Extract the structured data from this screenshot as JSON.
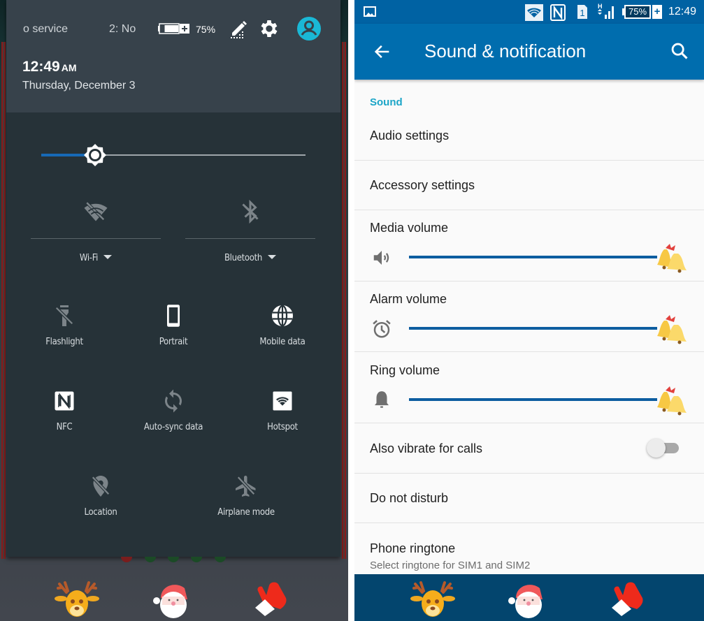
{
  "quick_settings": {
    "carrier_1": "o service",
    "carrier_2": "2: No",
    "battery_pct": "75%",
    "battery_level": 0.75,
    "time": "12:49",
    "ampm": "AM",
    "date": "Thursday, December 3",
    "header_icons": [
      "edit-icon",
      "settings-gear-icon",
      "user-account-icon"
    ],
    "brightness_level": 0.17,
    "big_tiles": [
      {
        "label": "Wi-Fi",
        "icon": "wifi-off-icon",
        "state": "off",
        "has_dropdown": true
      },
      {
        "label": "Bluetooth",
        "icon": "bluetooth-off-icon",
        "state": "off",
        "has_dropdown": true
      }
    ],
    "tiles": [
      {
        "label": "Flashlight",
        "icon": "flashlight-off-icon",
        "state": "off"
      },
      {
        "label": "Portrait",
        "icon": "portrait-phone-icon",
        "state": "on"
      },
      {
        "label": "Mobile data",
        "icon": "globe-icon",
        "state": "on"
      },
      {
        "label": "NFC",
        "icon": "nfc-icon",
        "state": "on"
      },
      {
        "label": "Auto-sync data",
        "icon": "sync-icon",
        "state": "off"
      },
      {
        "label": "Hotspot",
        "icon": "hotspot-icon",
        "state": "on"
      },
      {
        "label": "Location",
        "icon": "location-off-icon",
        "state": "off"
      },
      {
        "label": "Airplane mode",
        "icon": "airplane-off-icon",
        "state": "off"
      }
    ],
    "dock": [
      "reindeer-icon",
      "santa-icon",
      "mitten-icon"
    ]
  },
  "settings": {
    "status_bar": {
      "time": "12:49",
      "battery_pct": "75%",
      "sim_slot": "1",
      "network_type": "H",
      "icons": [
        "picture-notification-icon",
        "wifi-icon",
        "nfc-icon",
        "sim-icon",
        "signal-icon",
        "battery-icon"
      ]
    },
    "app_bar": {
      "title": "Sound & notification",
      "back_icon": "back-arrow-icon",
      "search_icon": "search-icon"
    },
    "section_title": "Sound",
    "items": {
      "audio_settings": "Audio settings",
      "accessory_settings": "Accessory settings",
      "media_volume": {
        "label": "Media volume",
        "level": 1.0,
        "icon": "speaker-icon"
      },
      "alarm_volume": {
        "label": "Alarm volume",
        "level": 1.0,
        "icon": "alarm-clock-icon"
      },
      "ring_volume": {
        "label": "Ring volume",
        "level": 1.0,
        "icon": "bell-icon"
      },
      "vibrate": {
        "label": "Also vibrate for calls",
        "enabled": false
      },
      "do_not_disturb": "Do not disturb",
      "phone_ringtone": {
        "label": "Phone ringtone",
        "summary": "Select ringtone for SIM1 and SIM2"
      }
    },
    "nav_icons": [
      "reindeer-icon",
      "santa-icon",
      "mitten-icon"
    ]
  },
  "colors": {
    "app_bar": "#006dae",
    "status_bar": "#0062a3",
    "accent": "#1ba5c7",
    "slider": "#0c5da0",
    "qs_panel": "#263238",
    "qs_header": "#37424b",
    "brightness_fill": "#1769b6",
    "nav_bar": "#03456e"
  }
}
